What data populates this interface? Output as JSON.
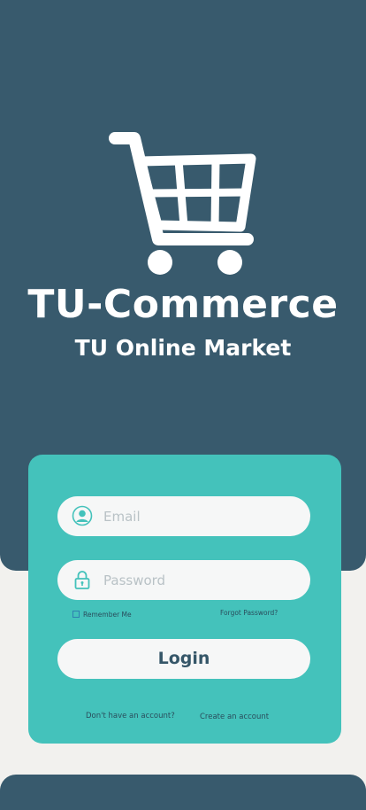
{
  "brand": {
    "title": "TU-Commerce",
    "subtitle": "TU Online Market",
    "logo_icon": "shopping-cart-icon"
  },
  "form": {
    "email": {
      "placeholder": "Email",
      "value": "",
      "icon": "user-circle-icon"
    },
    "password": {
      "placeholder": "Password",
      "value": "",
      "icon": "lock-icon"
    },
    "remember_me": {
      "label": "Remember Me",
      "checked": false
    },
    "forgot_password_label": "Forgot Password?",
    "login_label": "Login",
    "no_account_text": "Don't have an account?",
    "create_account_label": "Create an account"
  },
  "colors": {
    "header_bg": "#385a6d",
    "card_bg": "#44c2bb",
    "page_bg": "#f2f1ee",
    "field_bg": "#f6f7f7"
  }
}
